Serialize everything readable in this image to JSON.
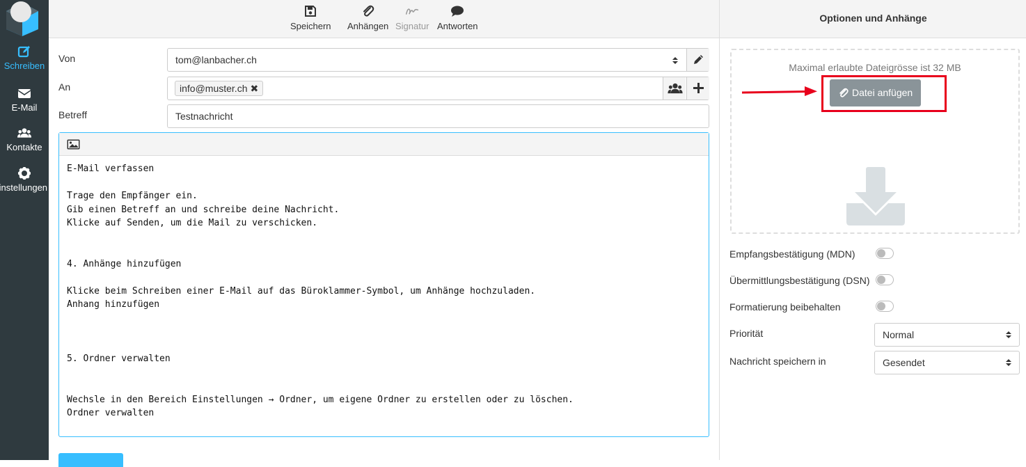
{
  "nav": {
    "items": [
      {
        "label": "Schreiben",
        "icon": "edit-icon",
        "active": true
      },
      {
        "label": "E-Mail",
        "icon": "envelope-icon",
        "active": false
      },
      {
        "label": "Kontakte",
        "icon": "users-icon",
        "active": false
      },
      {
        "label": "Einstellungen",
        "icon": "gear-icon",
        "active": false
      }
    ]
  },
  "toolbar": {
    "save_label": "Speichern",
    "attach_label": "Anhängen",
    "signature_label": "Signatur",
    "reply_label": "Antworten"
  },
  "compose": {
    "from_label": "Von",
    "from_value": "tom@lanbacher.ch",
    "to_label": "An",
    "to_recipient": "info@muster.ch",
    "subject_label": "Betreff",
    "subject_value": "Testnachricht",
    "body": "E-Mail verfassen\n\nTrage den Empfänger ein.\nGib einen Betreff an und schreibe deine Nachricht.\nKlicke auf Senden, um die Mail zu verschicken.\n\n\n4. Anhänge hinzufügen\n\nKlicke beim Schreiben einer E-Mail auf das Büroklammer-Symbol, um Anhänge hochzuladen.\nAnhang hinzufügen\n\n\n\n5. Ordner verwalten\n\n\nWechsle in den Bereich Einstellungen → Ordner, um eigene Ordner zu erstellen oder zu löschen.\nOrdner verwalten"
  },
  "sidebar": {
    "title": "Optionen und Anhänge",
    "max_size_text": "Maximal erlaubte Dateigrösse ist 32 MB",
    "attach_button_label": "Datei anfügen",
    "options": [
      {
        "label": "Empfangsbestätigung (MDN)",
        "enabled": false
      },
      {
        "label": "Übermittlungsbestätigung (DSN)",
        "enabled": false
      },
      {
        "label": "Formatierung beibehalten",
        "enabled": false
      }
    ],
    "priority_label": "Priorität",
    "priority_value": "Normal",
    "save_in_label": "Nachricht speichern in",
    "save_in_value": "Gesendet"
  },
  "colors": {
    "accent": "#37beff",
    "nav_bg": "#2f3a3f",
    "highlight": "#e8001c"
  }
}
